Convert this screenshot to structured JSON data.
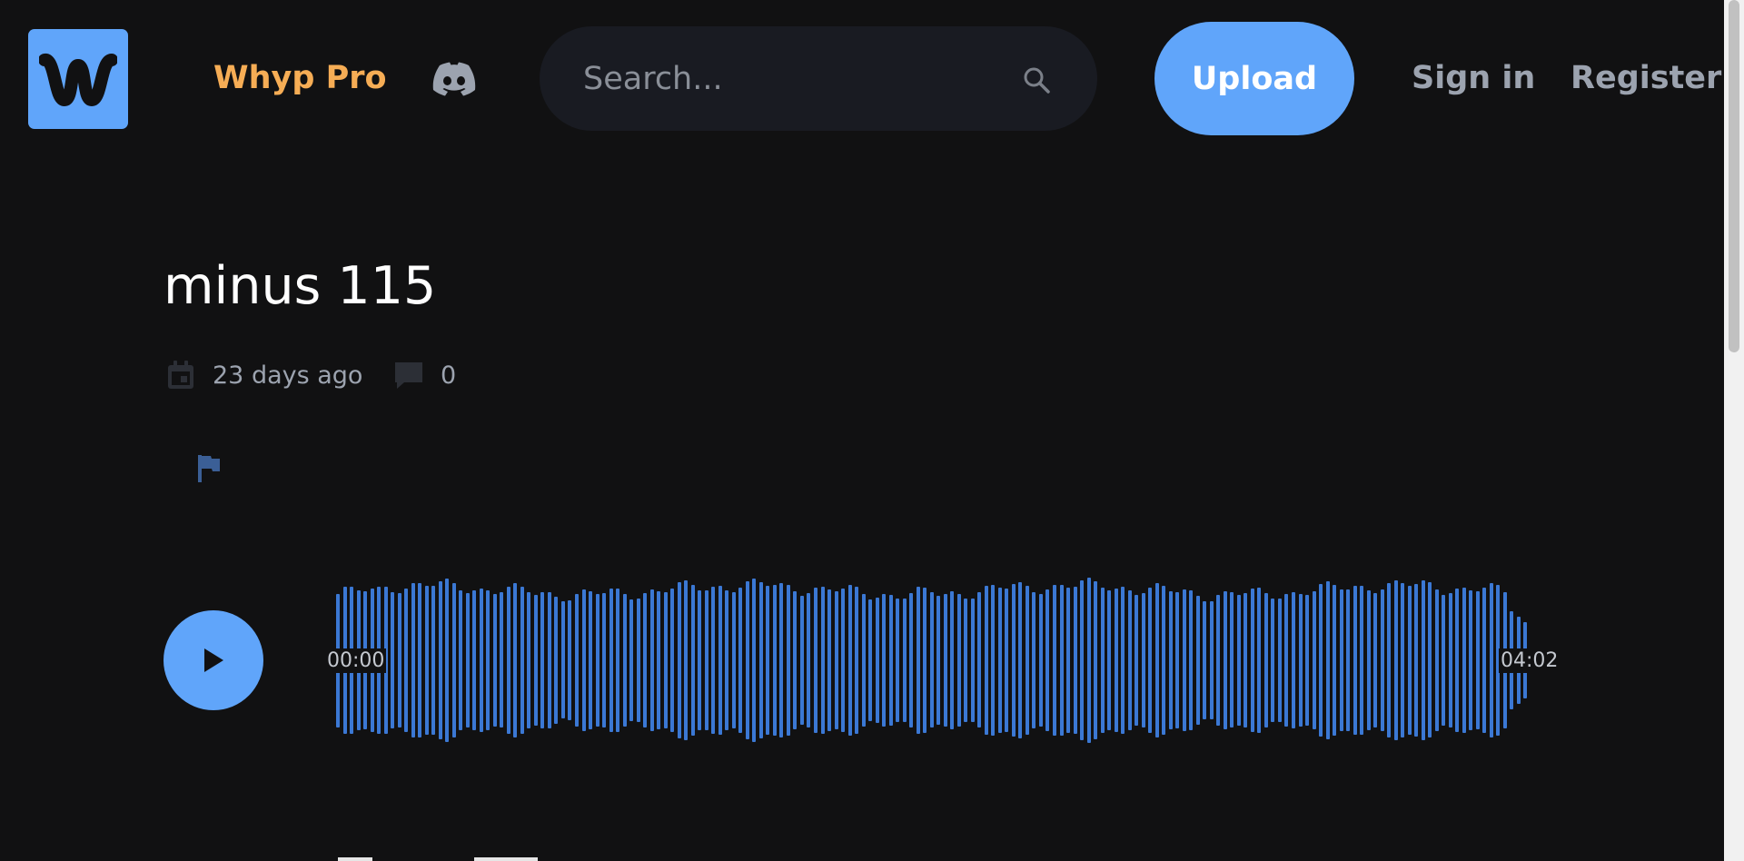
{
  "header": {
    "logo_letter": "W",
    "pro_label": "Whyp Pro",
    "discord_icon": "discord-icon",
    "search": {
      "placeholder": "Search...",
      "value": ""
    },
    "upload_label": "Upload",
    "signin_label": "Sign in",
    "register_label": "Register"
  },
  "track": {
    "title": "minus 115",
    "posted": "23 days ago",
    "comments_count": "0",
    "start_time": "00:00",
    "duration": "04:02",
    "progress": 0
  },
  "colors": {
    "background": "#111112",
    "accent": "#60a5fa",
    "pro": "#f6ad55",
    "waveform": "#3b78d4",
    "muted": "#9ca3af"
  },
  "icons": [
    "calendar-icon",
    "comment-icon",
    "flag-icon",
    "play-icon",
    "search-icon"
  ]
}
